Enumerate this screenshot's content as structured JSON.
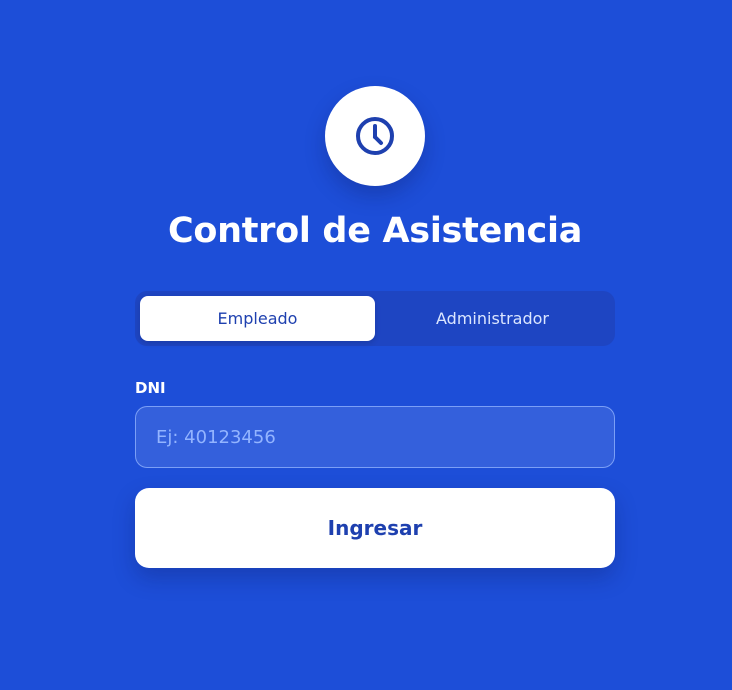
{
  "app": {
    "title": "Control de Asistencia",
    "icon": "clock-icon"
  },
  "tabs": [
    {
      "label": "Empleado",
      "active": true
    },
    {
      "label": "Administrador",
      "active": false
    }
  ],
  "form": {
    "dni_label": "DNI",
    "dni_placeholder": "Ej: 40123456",
    "dni_value": "",
    "submit_label": "Ingresar"
  },
  "colors": {
    "background": "#1d4ed8",
    "accent": "#1e40af",
    "tabs_track": "#1e45c2",
    "input_background": "#3460dc",
    "white": "#ffffff"
  }
}
